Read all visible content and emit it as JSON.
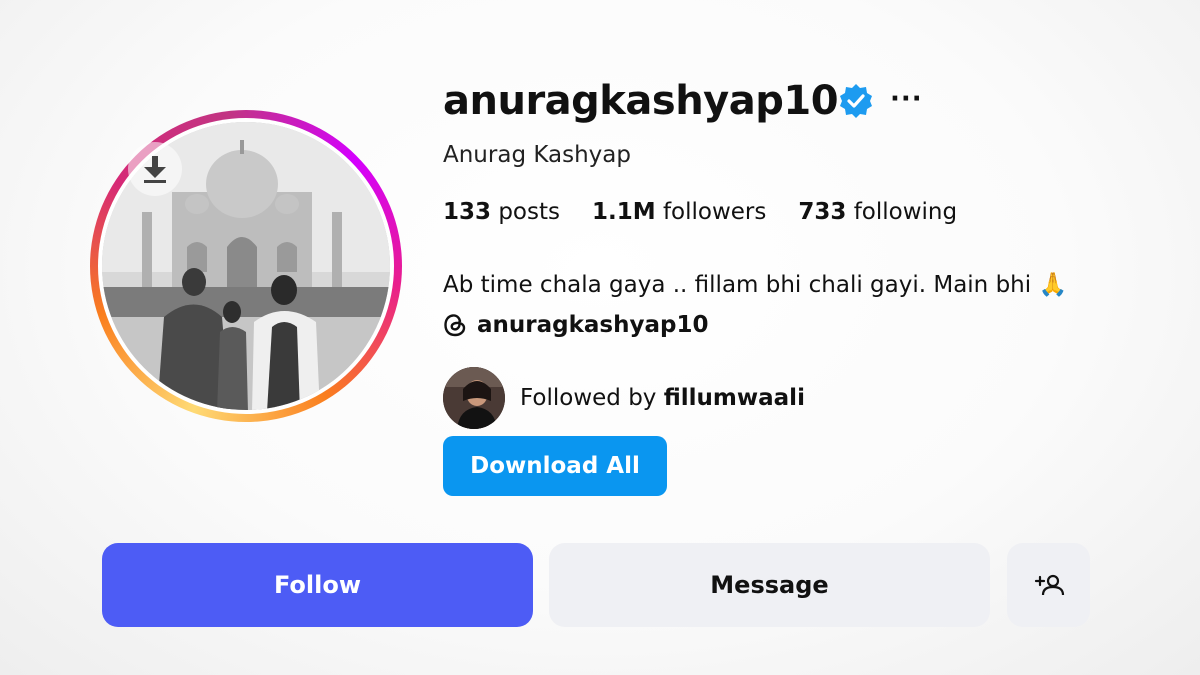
{
  "profile": {
    "username": "anuragkashyap10",
    "full_name": "Anurag Kashyap",
    "verified_icon": "verified-badge-icon",
    "more_label": "···"
  },
  "stats": {
    "posts_count": "133",
    "posts_label": "posts",
    "followers_count": "1.1M",
    "followers_label": "followers",
    "following_count": "733",
    "following_label": "following"
  },
  "bio": {
    "text": "Ab time chala gaya .. fillam bhi chali gayi. Main bhi 🙏",
    "threads_handle": "anuragkashyap10"
  },
  "followed_by": {
    "prefix": "Followed by ",
    "user": "fillumwaali"
  },
  "buttons": {
    "download_all": "Download All",
    "follow": "Follow",
    "message": "Message"
  },
  "colors": {
    "accent_blue": "#0a96f0",
    "follow_button": "#4d5cf5",
    "secondary_button": "#eff0f4",
    "verified": "#1d9bf0"
  }
}
